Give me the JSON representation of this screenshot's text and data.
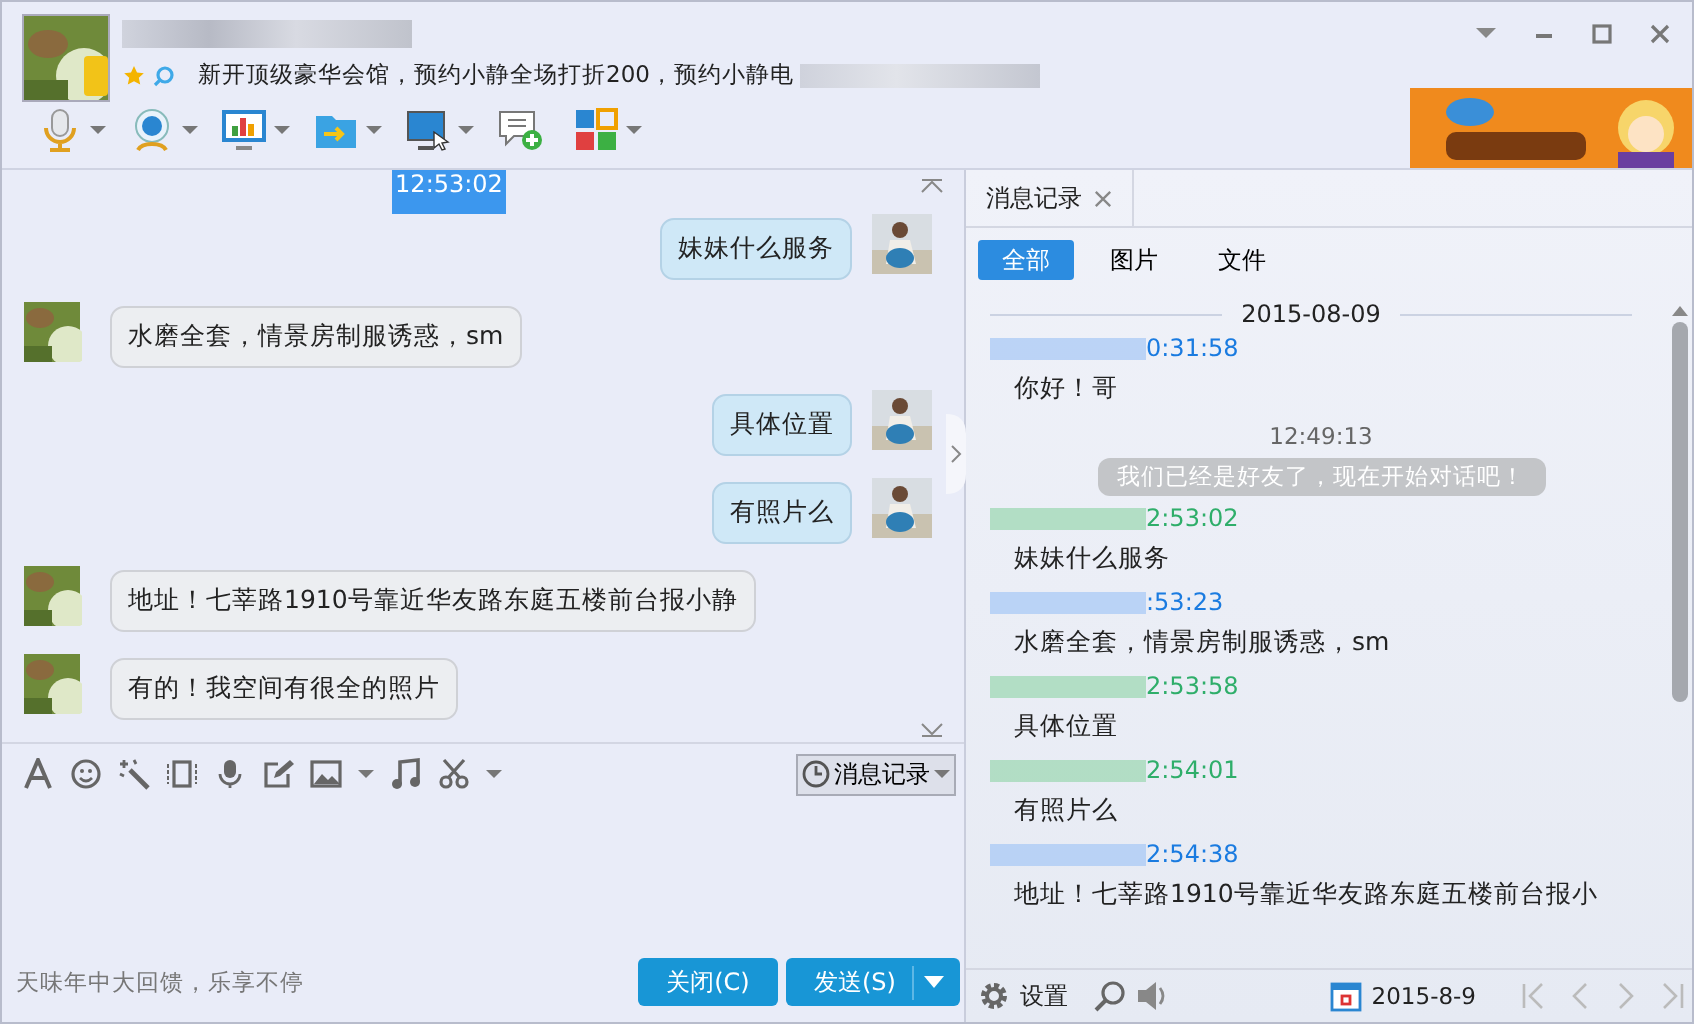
{
  "header": {
    "signature": "新开顶级豪华会馆，预约小静全场打折200，预约小静电"
  },
  "chat": {
    "time_marker": {
      "text": "12:53:02",
      "selected": true
    },
    "messages": [
      {
        "kind": "sent",
        "text": "妹妹什么服务"
      },
      {
        "kind": "received",
        "text": "水磨全套，情景房制服诱惑，sm"
      },
      {
        "kind": "sent",
        "text": "具体位置"
      },
      {
        "kind": "sent",
        "text": "有照片么"
      },
      {
        "kind": "received",
        "text": "地址！七莘路1910号靠近华友路东庭五楼前台报小静"
      },
      {
        "kind": "received",
        "text": "有的！我空间有很全的照片"
      }
    ]
  },
  "composer": {
    "history_button": "消息记录",
    "promo": "天味年中大回馈，乐享不停",
    "close_button": "关闭(C)",
    "send_button": "发送(S)"
  },
  "history": {
    "tab": "消息记录",
    "filters": [
      {
        "label": "全部",
        "selected": true
      },
      {
        "label": "图片",
        "selected": false
      },
      {
        "label": "文件",
        "selected": false
      }
    ],
    "date": "2015-08-09",
    "entries": [
      {
        "kind": "received",
        "time": "0:31:58",
        "text": "你好！哥"
      },
      {
        "kind": "system",
        "time": "12:49:13",
        "text": "我们已经是好友了，现在开始对话吧！"
      },
      {
        "kind": "sent",
        "time": "2:53:02",
        "text": "妹妹什么服务"
      },
      {
        "kind": "received",
        "time": ":53:23",
        "text": "水磨全套，情景房制服诱惑，sm"
      },
      {
        "kind": "sent",
        "time": "2:53:58",
        "text": "具体位置"
      },
      {
        "kind": "sent",
        "time": "2:54:01",
        "text": "有照片么"
      },
      {
        "kind": "received",
        "time": "2:54:38",
        "text": "地址！七莘路1910号靠近华友路东庭五楼前台报小"
      }
    ],
    "settings": "设置",
    "date_field": "2015-8-9"
  }
}
